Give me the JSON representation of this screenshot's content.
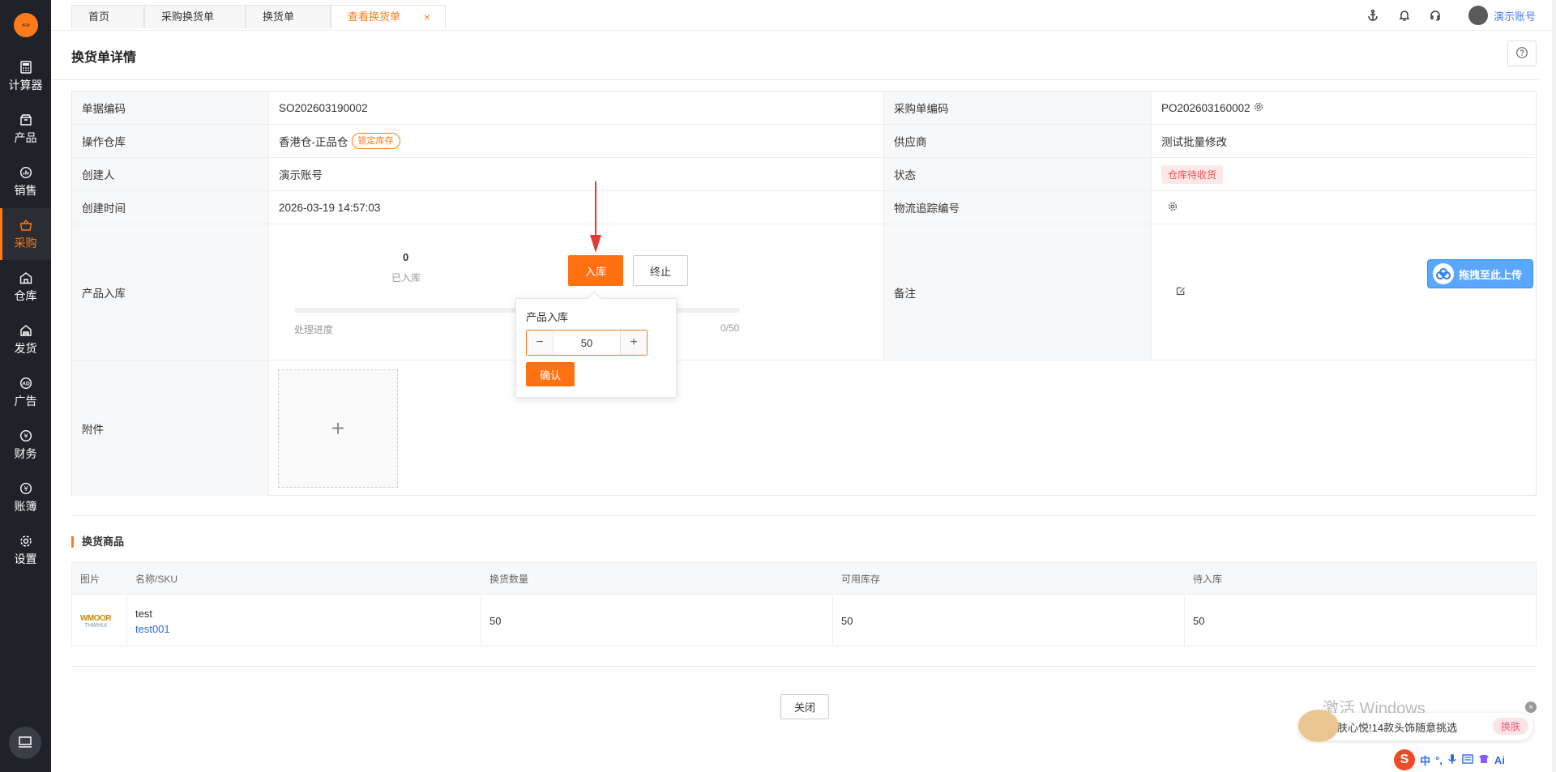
{
  "sidebar": {
    "logo": "⇔",
    "items": [
      {
        "label": "计算器",
        "icon": "calculator-icon",
        "active": false
      },
      {
        "label": "产品",
        "icon": "box-icon",
        "active": false
      },
      {
        "label": "销售",
        "icon": "chart-icon",
        "active": false
      },
      {
        "label": "采购",
        "icon": "basket-icon",
        "active": true
      },
      {
        "label": "仓库",
        "icon": "warehouse-icon",
        "active": false
      },
      {
        "label": "发货",
        "icon": "shipping-icon",
        "active": false
      },
      {
        "label": "广告",
        "icon": "ad-icon",
        "active": false
      },
      {
        "label": "财务",
        "icon": "yuan-icon",
        "active": false
      },
      {
        "label": "账簿",
        "icon": "ledger-icon",
        "active": false
      },
      {
        "label": "设置",
        "icon": "gear-icon",
        "active": false
      }
    ]
  },
  "tabs": [
    {
      "label": "首页"
    },
    {
      "label": "采购换货单"
    },
    {
      "label": "换货单"
    },
    {
      "label": "查看换货单",
      "close": "×"
    }
  ],
  "header": {
    "user_name": "演示账号"
  },
  "page": {
    "title": "换货单详情"
  },
  "detail": {
    "doc_no_label": "单据编码",
    "doc_no": "SO202603190002",
    "po_no_label": "采购单编码",
    "po_no": "PO202603160002",
    "warehouse_label": "操作仓库",
    "warehouse": "香港仓-正品仓",
    "warehouse_tag": "锁定库存",
    "supplier_label": "供应商",
    "supplier": "测试批量修改",
    "creator_label": "创建人",
    "creator": "演示账号",
    "status_label": "状态",
    "status": "仓库待收货",
    "created_time_label": "创建时间",
    "created_time": "2026-03-19 14:57:03",
    "tracking_label": "物流追踪编号",
    "stock_in_label": "产品入库",
    "remark_label": "备注",
    "attachment_label": "附件"
  },
  "stock_in": {
    "received_count": "0",
    "received_label": "已入库",
    "stock_in_button": "入库",
    "terminate_button": "终止",
    "progress_label": "处理进度",
    "progress_count": "0/50",
    "progress": 0
  },
  "popover": {
    "title": "产品入库",
    "quantity": "50",
    "confirm": "确认"
  },
  "upload": {
    "button": "拖拽至此上传"
  },
  "goods": {
    "section_title": "换货商品",
    "columns": [
      "图片",
      "名称/SKU",
      "换货数量",
      "可用库存",
      "待入库"
    ],
    "rows": [
      {
        "name": "test",
        "sku": "test001",
        "qty": "50",
        "available": "50",
        "pending": "50",
        "thumb_top": "WMOOR",
        "thumb_bottom": "THWHUI"
      }
    ]
  },
  "footer": {
    "close": "关闭"
  },
  "overlay": {
    "watermark": "激活 Windows",
    "ad_text": "肤心悦!14款头饰随意挑选",
    "ad_chip": "换肤",
    "ime": [
      "中",
      "°,",
      "Ai"
    ]
  }
}
